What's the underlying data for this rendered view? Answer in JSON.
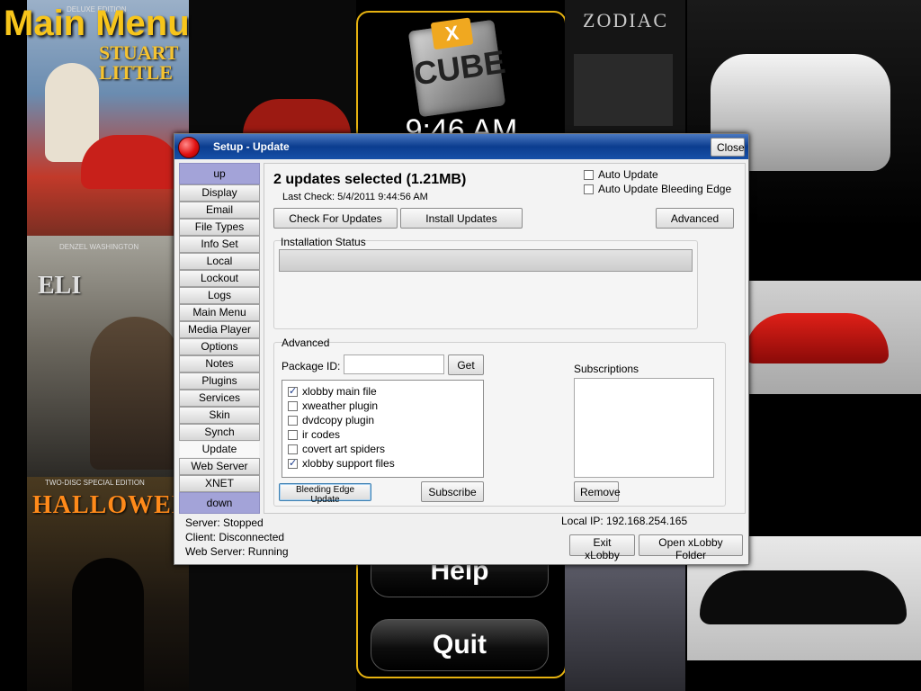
{
  "background": {
    "main_menu_title": "Main Menu",
    "clock": "9:46 AM",
    "cube_text": "CUBE",
    "cube_badge": "X",
    "menu_buttons": [
      "Help",
      "Quit"
    ],
    "posters": {
      "stuart": {
        "title": "STUART LITTLE",
        "top_text": "DELUXE EDITION"
      },
      "eli": {
        "title": "ELI",
        "top_text": "DENZEL WASHINGTON"
      },
      "halloween": {
        "title": "HALLOWEEN",
        "top_text": "TWO-DISC SPECIAL EDITION"
      }
    },
    "right_poster_text": "ZODIAC"
  },
  "dialog": {
    "title": "Setup - Update",
    "close_label": "Close",
    "sidebar": {
      "up_label": "up",
      "down_label": "down",
      "items": [
        "Display",
        "Email",
        "File Types",
        "Info Set",
        "Local",
        "Lockout",
        "Logs",
        "Main Menu",
        "Media Player",
        "Options",
        "Notes",
        "Plugins",
        "Services",
        "Skin",
        "Synch",
        "Update",
        "Web Server",
        "XNET"
      ],
      "active": "Update"
    },
    "update": {
      "summary": "2 updates selected (1.21MB)",
      "last_check": "Last Check: 5/4/2011 9:44:56 AM",
      "auto_update": {
        "label": "Auto Update",
        "checked": false
      },
      "auto_update_bleeding": {
        "label": "Auto Update Bleeding Edge",
        "checked": false
      },
      "check_button": "Check For Updates",
      "install_button": "Install Updates",
      "advanced_button": "Advanced",
      "installation_status_label": "Installation Status",
      "progress": 0
    },
    "advanced": {
      "group_label": "Advanced",
      "package_id_label": "Package ID:",
      "package_id_value": "",
      "get_button": "Get",
      "plugins": [
        {
          "label": "xlobby main file",
          "checked": true
        },
        {
          "label": "xweather plugin",
          "checked": false
        },
        {
          "label": "dvdcopy plugin",
          "checked": false
        },
        {
          "label": "ir codes",
          "checked": false
        },
        {
          "label": "covert art spiders",
          "checked": false
        },
        {
          "label": "xlobby support files",
          "checked": true
        }
      ],
      "bleeding_button": "Bleeding Edge Update",
      "subscribe_button": "Subscribe",
      "subscriptions_label": "Subscriptions",
      "subscriptions": [],
      "remove_button": "Remove"
    },
    "status": {
      "server": "Server: Stopped",
      "client": "Client: Disconnected",
      "web_server": "Web Server: Running",
      "local_ip": "Local IP: 192.168.254.165"
    },
    "exit_button": "Exit xLobby",
    "open_folder_button": "Open xLobby Folder"
  },
  "colors": {
    "accent_yellow": "#f7c51b",
    "titlebar_blue": "#0b3d8f",
    "nav_purple": "#a3a3d8"
  }
}
